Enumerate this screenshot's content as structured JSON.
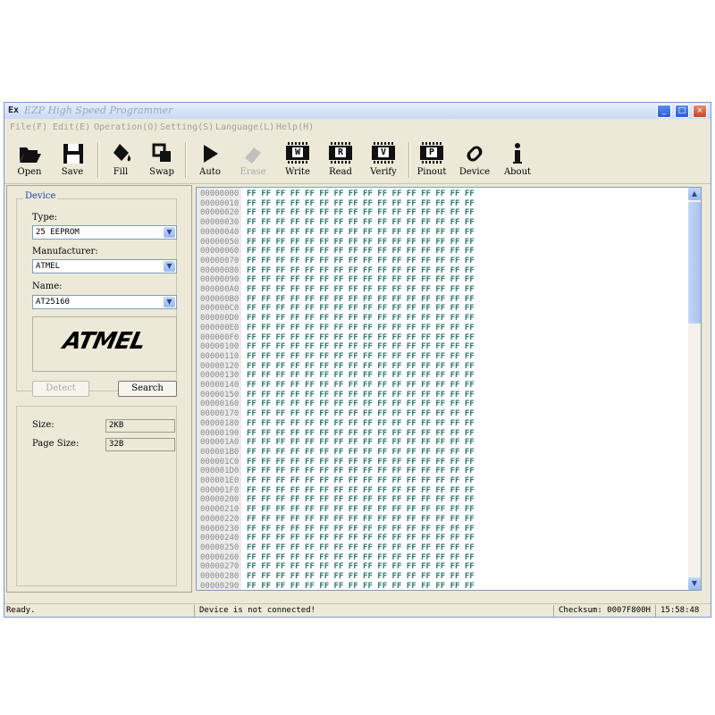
{
  "window": {
    "title": "EZP High Speed Programmer",
    "app_icon_text": "Ex",
    "controls": [
      "_",
      "□",
      "×"
    ]
  },
  "menu": [
    "File(F)",
    "Edit(E)",
    "Operation(O)",
    "Setting(S)",
    "Language(L)",
    "Help(H)"
  ],
  "toolbar": {
    "open": "Open",
    "save": "Save",
    "fill": "Fill",
    "swap": "Swap",
    "auto": "Auto",
    "erase": "Erase",
    "write": "Write",
    "read": "Read",
    "verify": "Verify",
    "pinout": "Pinout",
    "device": "Device",
    "about": "About",
    "chip_letters": {
      "write": "W",
      "read": "R",
      "verify": "V",
      "pinout": "P"
    }
  },
  "device": {
    "group_title": "Device",
    "type_label": "Type:",
    "type_value": "25 EEPROM",
    "manufacturer_label": "Manufacturer:",
    "manufacturer_value": "ATMEL",
    "name_label": "Name:",
    "name_value": "AT25160",
    "logo_text": "ATMEL",
    "detect_label": "Detect",
    "search_label": "Search",
    "size_label": "Size:",
    "size_value": "2KB",
    "page_size_label": "Page Size:",
    "page_size_value": "32B"
  },
  "hex": {
    "rows": [
      {
        "addr": "00000000",
        "bytes": "FF FF FF FF FF FF FF FF FF FF FF FF FF FF FF FF"
      },
      {
        "addr": "00000010",
        "bytes": "FF FF FF FF FF FF FF FF FF FF FF FF FF FF FF FF"
      },
      {
        "addr": "00000020",
        "bytes": "FF FF FF FF FF FF FF FF FF FF FF FF FF FF FF FF"
      },
      {
        "addr": "00000030",
        "bytes": "FF FF FF FF FF FF FF FF FF FF FF FF FF FF FF FF"
      },
      {
        "addr": "00000040",
        "bytes": "FF FF FF FF FF FF FF FF FF FF FF FF FF FF FF FF"
      },
      {
        "addr": "00000050",
        "bytes": "FF FF FF FF FF FF FF FF FF FF FF FF FF FF FF FF"
      },
      {
        "addr": "00000060",
        "bytes": "FF FF FF FF FF FF FF FF FF FF FF FF FF FF FF FF"
      },
      {
        "addr": "00000070",
        "bytes": "FF FF FF FF FF FF FF FF FF FF FF FF FF FF FF FF"
      },
      {
        "addr": "00000080",
        "bytes": "FF FF FF FF FF FF FF FF FF FF FF FF FF FF FF FF"
      },
      {
        "addr": "00000090",
        "bytes": "FF FF FF FF FF FF FF FF FF FF FF FF FF FF FF FF"
      },
      {
        "addr": "000000A0",
        "bytes": "FF FF FF FF FF FF FF FF FF FF FF FF FF FF FF FF"
      },
      {
        "addr": "000000B0",
        "bytes": "FF FF FF FF FF FF FF FF FF FF FF FF FF FF FF FF"
      },
      {
        "addr": "000000C0",
        "bytes": "FF FF FF FF FF FF FF FF FF FF FF FF FF FF FF FF"
      },
      {
        "addr": "000000D0",
        "bytes": "FF FF FF FF FF FF FF FF FF FF FF FF FF FF FF FF"
      },
      {
        "addr": "000000E0",
        "bytes": "FF FF FF FF FF FF FF FF FF FF FF FF FF FF FF FF"
      },
      {
        "addr": "000000F0",
        "bytes": "FF FF FF FF FF FF FF FF FF FF FF FF FF FF FF FF"
      },
      {
        "addr": "00000100",
        "bytes": "FF FF FF FF FF FF FF FF FF FF FF FF FF FF FF FF"
      },
      {
        "addr": "00000110",
        "bytes": "FF FF FF FF FF FF FF FF FF FF FF FF FF FF FF FF"
      },
      {
        "addr": "00000120",
        "bytes": "FF FF FF FF FF FF FF FF FF FF FF FF FF FF FF FF"
      },
      {
        "addr": "00000130",
        "bytes": "FF FF FF FF FF FF FF FF FF FF FF FF FF FF FF FF"
      },
      {
        "addr": "00000140",
        "bytes": "FF FF FF FF FF FF FF FF FF FF FF FF FF FF FF FF"
      },
      {
        "addr": "00000150",
        "bytes": "FF FF FF FF FF FF FF FF FF FF FF FF FF FF FF FF"
      },
      {
        "addr": "00000160",
        "bytes": "FF FF FF FF FF FF FF FF FF FF FF FF FF FF FF FF"
      },
      {
        "addr": "00000170",
        "bytes": "FF FF FF FF FF FF FF FF FF FF FF FF FF FF FF FF"
      },
      {
        "addr": "00000180",
        "bytes": "FF FF FF FF FF FF FF FF FF FF FF FF FF FF FF FF"
      },
      {
        "addr": "00000190",
        "bytes": "FF FF FF FF FF FF FF FF FF FF FF FF FF FF FF FF"
      },
      {
        "addr": "000001A0",
        "bytes": "FF FF FF FF FF FF FF FF FF FF FF FF FF FF FF FF"
      },
      {
        "addr": "000001B0",
        "bytes": "FF FF FF FF FF FF FF FF FF FF FF FF FF FF FF FF"
      },
      {
        "addr": "000001C0",
        "bytes": "FF FF FF FF FF FF FF FF FF FF FF FF FF FF FF FF"
      },
      {
        "addr": "000001D0",
        "bytes": "FF FF FF FF FF FF FF FF FF FF FF FF FF FF FF FF"
      },
      {
        "addr": "000001E0",
        "bytes": "FF FF FF FF FF FF FF FF FF FF FF FF FF FF FF FF"
      },
      {
        "addr": "000001F0",
        "bytes": "FF FF FF FF FF FF FF FF FF FF FF FF FF FF FF FF"
      },
      {
        "addr": "00000200",
        "bytes": "FF FF FF FF FF FF FF FF FF FF FF FF FF FF FF FF"
      },
      {
        "addr": "00000210",
        "bytes": "FF FF FF FF FF FF FF FF FF FF FF FF FF FF FF FF"
      },
      {
        "addr": "00000220",
        "bytes": "FF FF FF FF FF FF FF FF FF FF FF FF FF FF FF FF"
      },
      {
        "addr": "00000230",
        "bytes": "FF FF FF FF FF FF FF FF FF FF FF FF FF FF FF FF"
      },
      {
        "addr": "00000240",
        "bytes": "FF FF FF FF FF FF FF FF FF FF FF FF FF FF FF FF"
      },
      {
        "addr": "00000250",
        "bytes": "FF FF FF FF FF FF FF FF FF FF FF FF FF FF FF FF"
      },
      {
        "addr": "00000260",
        "bytes": "FF FF FF FF FF FF FF FF FF FF FF FF FF FF FF FF"
      },
      {
        "addr": "00000270",
        "bytes": "FF FF FF FF FF FF FF FF FF FF FF FF FF FF FF FF"
      },
      {
        "addr": "00000280",
        "bytes": "FF FF FF FF FF FF FF FF FF FF FF FF FF FF FF FF"
      },
      {
        "addr": "00000290",
        "bytes": "FF FF FF FF FF FF FF FF FF FF FF FF FF FF FF FF"
      }
    ]
  },
  "status": {
    "ready": "Ready.",
    "connection": "Device is not connected!",
    "checksum": "Checksum: 0007F800H",
    "time": "15:58:48"
  },
  "colors": {
    "hex_bytes": "#2d7a6a",
    "address": "#8c8c8c",
    "window_bg": "#ece9d8",
    "group_title": "#1a3fa6"
  }
}
